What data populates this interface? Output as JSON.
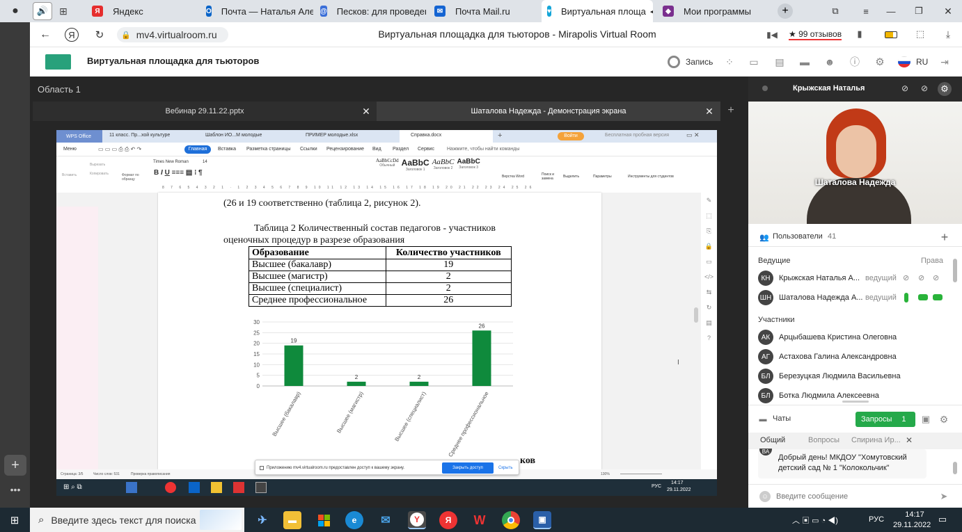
{
  "browser": {
    "tabs": [
      {
        "label": "Яндекс",
        "color": "#e62e2e",
        "glyph": "Я"
      },
      {
        "label": "Почта — Наталья Алек",
        "color": "#0a64c8",
        "glyph": "О"
      },
      {
        "label": "Песков: для проведени",
        "color": "#3b6fd8",
        "glyph": "@"
      },
      {
        "label": "Почта Mail.ru",
        "color": "#1464d2",
        "glyph": "✉"
      },
      {
        "label": "Виртуальная площа",
        "color": "#13a5d8",
        "glyph": "♥"
      },
      {
        "label": "Мои программы",
        "color": "#7a2f8e",
        "glyph": "◆"
      }
    ],
    "url": "mv4.virtualroom.ru",
    "page_title": "Виртуальная площадка для тьюторов - Mirapolis Virtual Room",
    "reviews": "★ 99 отзывов"
  },
  "app": {
    "title": "Виртуальная площадка для тьюторов",
    "record_label": "Запись",
    "lang": "RU",
    "region": "Область 1",
    "screen_tabs": [
      "Вебинар 29.11.22.pptx",
      "Шаталова Надежда - Демонстрация экрана"
    ]
  },
  "wps": {
    "tabs": [
      "WPS Office",
      "11 класс. Пр...хой культуре",
      "Шаблон ИО...М молодые",
      "ПРИМЕР молодые.xlsx",
      "Справка.docx"
    ],
    "login": "Войти",
    "trial": "Бесплатная пробная версия",
    "menu": [
      "Меню",
      "Главная",
      "Вставка",
      "Разметка страницы",
      "Ссылки",
      "Рецензирование",
      "Вид",
      "Раздел",
      "Сервис"
    ],
    "search_hint": "Нажмите, чтобы найти команды",
    "font_name": "Times New Roman",
    "font_size": "14",
    "styles": [
      "AaBbCcDd",
      "AaBbC",
      "AaBbC",
      "AaBbC"
    ],
    "style_names": [
      "Обычный",
      "Заголовок 1",
      "Заголовок 2",
      "Заголовок 3"
    ],
    "ribbon_right": [
      "Верстка Word",
      "Поиск и замена",
      "Выделить",
      "Параметры",
      "Инструменты для студентов"
    ],
    "ribbon_left": [
      "Вставить",
      "Вырезать",
      "Копировать",
      "Формат по образцу"
    ],
    "status": {
      "page": "Страница: 3/5",
      "words": "Число слов: 531",
      "spell": "Проверка правописания",
      "zoom": "130%"
    },
    "share_notice": "Приложению mv4.virtualroom.ru предоставлен доступ к вашему экрану.",
    "share_stop": "Закрыть доступ",
    "share_hide": "Скрыть",
    "win_time": "14:17",
    "win_date": "29.11.2022",
    "win_lang": "РУС"
  },
  "document": {
    "partial_line": "(26 и 19 соответственно (таблица 2, рисунок 2).",
    "caption_line1": "Таблица 2 Количественный состав педагогов - участников",
    "caption_line2": "оценочных процедур в разрезе образования",
    "table_headers": [
      "Образование",
      "Количество участников"
    ],
    "table_rows": [
      [
        "Высшее (бакалавр)",
        "19"
      ],
      [
        "Высшее (магистр)",
        "2"
      ],
      [
        "Высшее (специалист)",
        "2"
      ],
      [
        "Среднее профессиональное",
        "26"
      ]
    ],
    "bottom_fragment": "ков"
  },
  "chart_data": {
    "type": "bar",
    "categories": [
      "Высшее (бакалавр)",
      "Высшее (магистр)",
      "Высшее (специалист)",
      "Среднее профессиональное"
    ],
    "values": [
      19,
      2,
      2,
      26
    ],
    "ylim": [
      0,
      30
    ],
    "yticks": [
      0,
      5,
      10,
      15,
      20,
      25,
      30
    ],
    "grid": true,
    "bar_color": "#0f8a3c"
  },
  "video": {
    "name": "Шаталова Надежда",
    "host_name": "Крыжская Наталья"
  },
  "users": {
    "title": "Пользователи",
    "count": "41",
    "hosts_label": "Ведущие",
    "rights_label": "Права",
    "participants_label": "Участники",
    "hosts": [
      {
        "initials": "КН",
        "name": "Крыжская Наталья А...",
        "role": "ведущий",
        "active": false
      },
      {
        "initials": "ШН",
        "name": "Шаталова Надежда А...",
        "role": "ведущий",
        "active": true
      }
    ],
    "participants": [
      {
        "initials": "АК",
        "name": "Арцыбашева Кристина Олеговна"
      },
      {
        "initials": "АГ",
        "name": "Астахова Галина Александровна"
      },
      {
        "initials": "БЛ",
        "name": "Березуцкая Людмила Васильевна"
      },
      {
        "initials": "БЛ",
        "name": "Ботка Людмила Алексеевна"
      }
    ]
  },
  "chats": {
    "title": "Чаты",
    "requests_label": "Запросы",
    "requests_count": "1",
    "tabs": [
      "Общий",
      "Вопросы",
      "Спирина Ир..."
    ],
    "avatar": "ВА",
    "message": "Добрый день! МКДОУ \"Хомутовский детский сад № 1 \"Колокольчик\"",
    "input_placeholder": "Введите сообщение"
  },
  "taskbar": {
    "search_placeholder": "Введите здесь текст для поиска",
    "time": "14:17",
    "date": "29.11.2022",
    "lang": "РУС"
  }
}
